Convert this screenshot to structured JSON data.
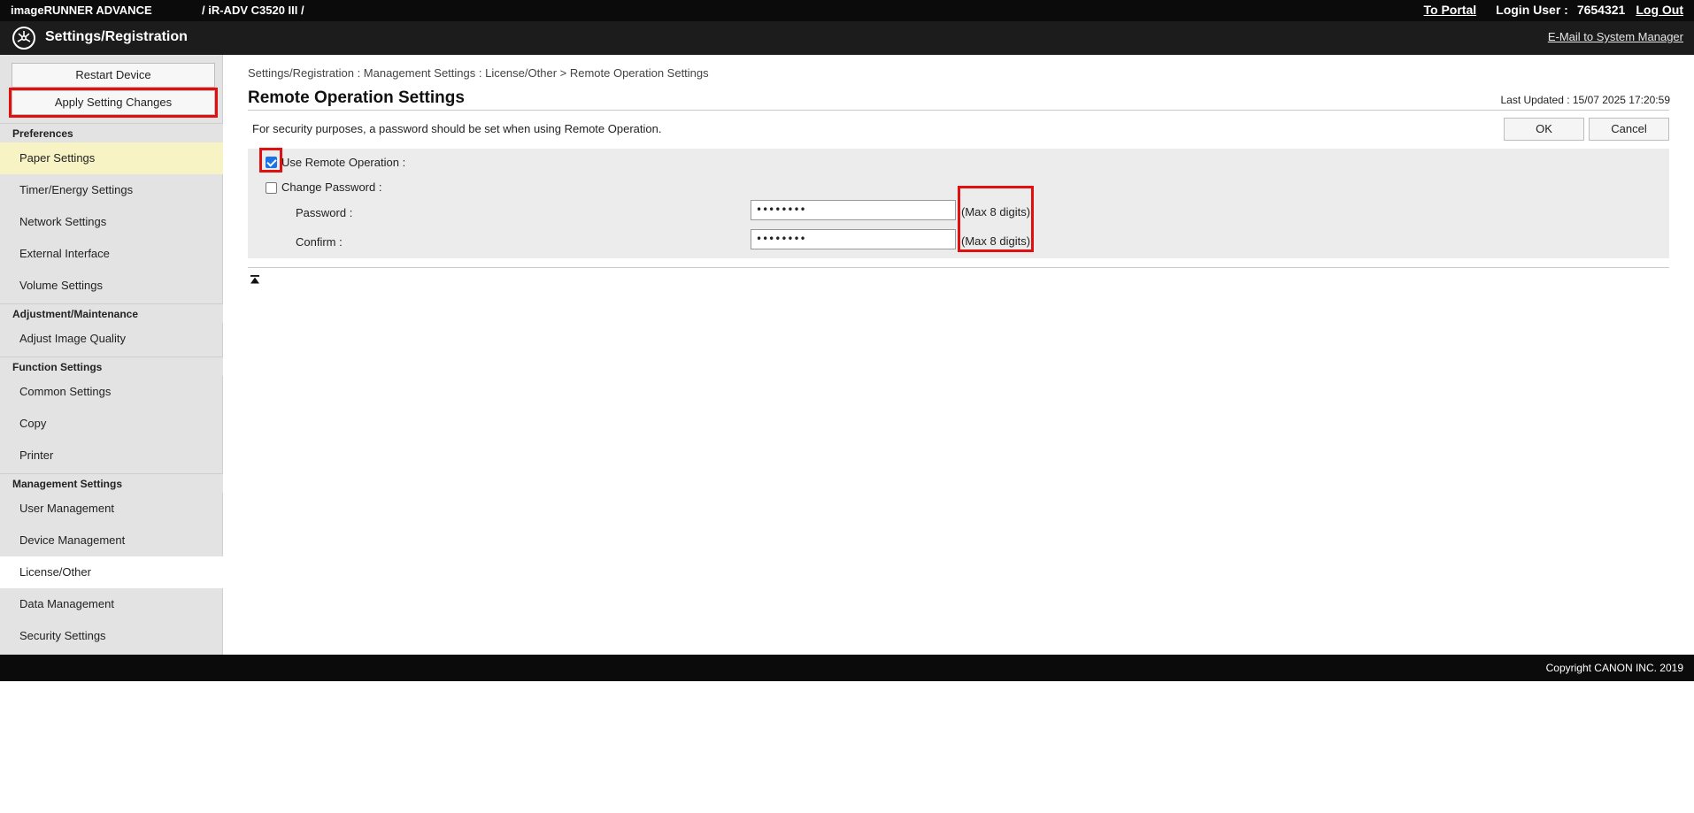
{
  "topbar": {
    "brand": "imageRUNNER ADVANCE",
    "model": "/ iR-ADV C3520 III /",
    "to_portal": "To Portal",
    "login_label": "Login User :",
    "login_user": "7654321",
    "logout": "Log Out"
  },
  "appbar": {
    "logo_icon": "settings-registration-icon",
    "title": "Settings/Registration",
    "mail_link": "E-Mail to System Manager"
  },
  "sidebar": {
    "restart": "Restart Device",
    "apply": "Apply Setting Changes",
    "sections": {
      "preferences": "Preferences",
      "adjustment": "Adjustment/Maintenance",
      "function": "Function Settings",
      "management": "Management Settings"
    },
    "items": {
      "paper": "Paper Settings",
      "timer": "Timer/Energy Settings",
      "network": "Network Settings",
      "external": "External Interface",
      "volume": "Volume Settings",
      "image_quality": "Adjust Image Quality",
      "common": "Common Settings",
      "copy": "Copy",
      "printer": "Printer",
      "user_mgmt": "User Management",
      "device_mgmt": "Device Management",
      "license": "License/Other",
      "data_mgmt": "Data Management",
      "security": "Security Settings"
    }
  },
  "main": {
    "breadcrumb": "Settings/Registration : Management Settings : License/Other > Remote Operation Settings",
    "title": "Remote Operation Settings",
    "last_updated": "Last Updated : 15/07 2025 17:20:59",
    "note": "For security purposes, a password should be set when using Remote Operation.",
    "ok": "OK",
    "cancel": "Cancel",
    "use_remote": {
      "label": "Use Remote Operation :",
      "checked": true
    },
    "change_password": {
      "label": "Change Password :",
      "checked": false
    },
    "password": {
      "label": "Password :",
      "value": "••••••••",
      "hint": "(Max 8 digits)"
    },
    "confirm": {
      "label": "Confirm :",
      "value": "••••••••",
      "hint": "(Max 8 digits)"
    },
    "to_top_icon": "to-top-icon"
  },
  "footer": {
    "copyright": "Copyright CANON INC. 2019"
  },
  "colors": {
    "highlight": "#e01010",
    "selected_item": "#f8f3c4",
    "checkbox": "#1a73e8"
  }
}
